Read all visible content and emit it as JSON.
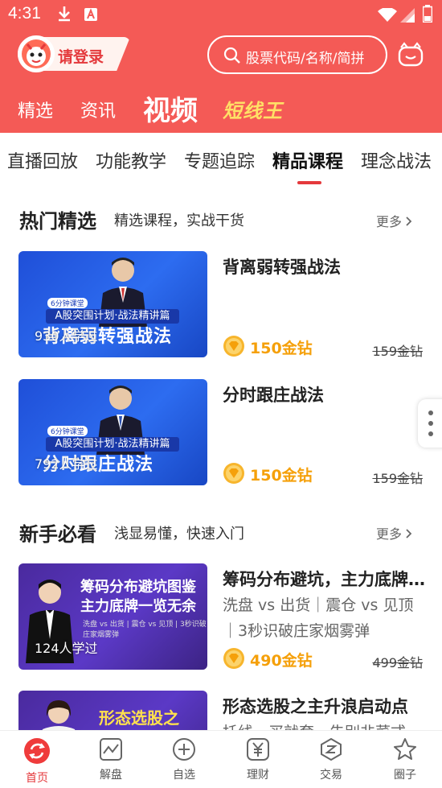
{
  "status_bar": {
    "time": "4:31"
  },
  "header": {
    "login_label": "请登录",
    "search_placeholder": "股票代码/名称/简拼",
    "tabs": [
      "精选",
      "资讯",
      "视频",
      "短线王"
    ],
    "active_tab": "视频"
  },
  "sub_tabs": [
    "直播回放",
    "功能教学",
    "专题追踪",
    "精品课程",
    "理念战法"
  ],
  "active_sub_tab": "精品课程",
  "sections": [
    {
      "title": "热门精选",
      "subtitle": "精选课程，实战干货",
      "more": "更多",
      "courses": [
        {
          "title": "背离弱转强战法",
          "learners": "930人学过",
          "price": "150金钻",
          "original_price": "159金钻",
          "thumb_tag": "6分钟课堂",
          "thumb_banner": "A股突围计划·战法精讲篇",
          "thumb_title": "背离弱转强战法"
        },
        {
          "title": "分时跟庄战法",
          "learners": "792人学过",
          "price": "150金钻",
          "original_price": "159金钻",
          "thumb_tag": "6分钟课堂",
          "thumb_banner": "A股突围计划·战法精讲篇",
          "thumb_title": "分时跟庄战法"
        }
      ]
    },
    {
      "title": "新手必看",
      "subtitle": "浅显易懂，快速入门",
      "more": "更多",
      "courses": [
        {
          "title": "筹码分布避坑，主力底牌一览无余",
          "description": "洗盘 vs 出货｜震仓 vs 见顶｜3秒识破庄家烟雾弹",
          "learners": "124人学过",
          "price": "490金钻",
          "original_price": "499金钻",
          "thumb_title": "筹码分布避坑图鉴 主力底牌一览无余",
          "thumb_strip": "洗盘 vs 出货 | 震仓 vs 见顶 | 3秒识破庄家烟雾弹"
        },
        {
          "title": "形态选股之主升浪启动点",
          "description": "托线，买就套，告别韭菜式",
          "thumb_title": "形态选股之"
        }
      ]
    }
  ],
  "bottom_nav": [
    "首页",
    "解盘",
    "自选",
    "理财",
    "交易",
    "圈子"
  ],
  "active_bottom_nav": "首页",
  "colors": {
    "brand_red": "#f45a56",
    "accent_red": "#e4393c",
    "gold": "#f5a00a",
    "highlight_yellow": "#ffe066"
  }
}
